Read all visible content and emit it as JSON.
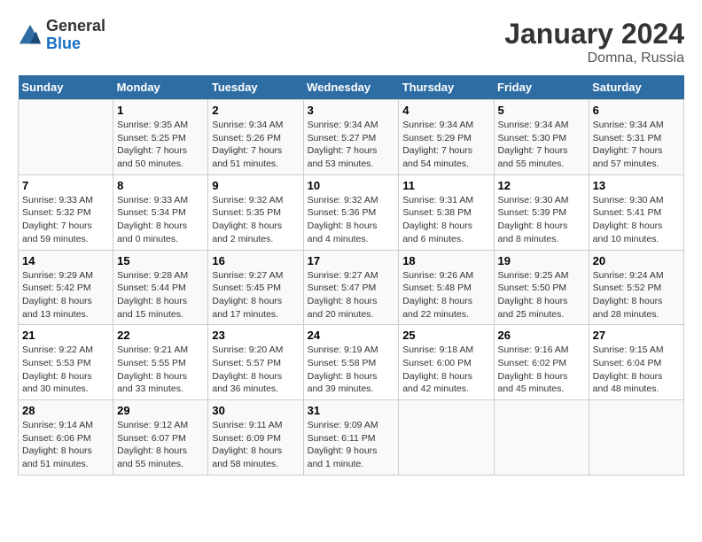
{
  "header": {
    "logo_general": "General",
    "logo_blue": "Blue",
    "title": "January 2024",
    "subtitle": "Domna, Russia"
  },
  "days_of_week": [
    "Sunday",
    "Monday",
    "Tuesday",
    "Wednesday",
    "Thursday",
    "Friday",
    "Saturday"
  ],
  "weeks": [
    [
      {
        "day": "",
        "info": ""
      },
      {
        "day": "1",
        "info": "Sunrise: 9:35 AM\nSunset: 5:25 PM\nDaylight: 7 hours\nand 50 minutes."
      },
      {
        "day": "2",
        "info": "Sunrise: 9:34 AM\nSunset: 5:26 PM\nDaylight: 7 hours\nand 51 minutes."
      },
      {
        "day": "3",
        "info": "Sunrise: 9:34 AM\nSunset: 5:27 PM\nDaylight: 7 hours\nand 53 minutes."
      },
      {
        "day": "4",
        "info": "Sunrise: 9:34 AM\nSunset: 5:29 PM\nDaylight: 7 hours\nand 54 minutes."
      },
      {
        "day": "5",
        "info": "Sunrise: 9:34 AM\nSunset: 5:30 PM\nDaylight: 7 hours\nand 55 minutes."
      },
      {
        "day": "6",
        "info": "Sunrise: 9:34 AM\nSunset: 5:31 PM\nDaylight: 7 hours\nand 57 minutes."
      }
    ],
    [
      {
        "day": "7",
        "info": "Sunrise: 9:33 AM\nSunset: 5:32 PM\nDaylight: 7 hours\nand 59 minutes."
      },
      {
        "day": "8",
        "info": "Sunrise: 9:33 AM\nSunset: 5:34 PM\nDaylight: 8 hours\nand 0 minutes."
      },
      {
        "day": "9",
        "info": "Sunrise: 9:32 AM\nSunset: 5:35 PM\nDaylight: 8 hours\nand 2 minutes."
      },
      {
        "day": "10",
        "info": "Sunrise: 9:32 AM\nSunset: 5:36 PM\nDaylight: 8 hours\nand 4 minutes."
      },
      {
        "day": "11",
        "info": "Sunrise: 9:31 AM\nSunset: 5:38 PM\nDaylight: 8 hours\nand 6 minutes."
      },
      {
        "day": "12",
        "info": "Sunrise: 9:30 AM\nSunset: 5:39 PM\nDaylight: 8 hours\nand 8 minutes."
      },
      {
        "day": "13",
        "info": "Sunrise: 9:30 AM\nSunset: 5:41 PM\nDaylight: 8 hours\nand 10 minutes."
      }
    ],
    [
      {
        "day": "14",
        "info": "Sunrise: 9:29 AM\nSunset: 5:42 PM\nDaylight: 8 hours\nand 13 minutes."
      },
      {
        "day": "15",
        "info": "Sunrise: 9:28 AM\nSunset: 5:44 PM\nDaylight: 8 hours\nand 15 minutes."
      },
      {
        "day": "16",
        "info": "Sunrise: 9:27 AM\nSunset: 5:45 PM\nDaylight: 8 hours\nand 17 minutes."
      },
      {
        "day": "17",
        "info": "Sunrise: 9:27 AM\nSunset: 5:47 PM\nDaylight: 8 hours\nand 20 minutes."
      },
      {
        "day": "18",
        "info": "Sunrise: 9:26 AM\nSunset: 5:48 PM\nDaylight: 8 hours\nand 22 minutes."
      },
      {
        "day": "19",
        "info": "Sunrise: 9:25 AM\nSunset: 5:50 PM\nDaylight: 8 hours\nand 25 minutes."
      },
      {
        "day": "20",
        "info": "Sunrise: 9:24 AM\nSunset: 5:52 PM\nDaylight: 8 hours\nand 28 minutes."
      }
    ],
    [
      {
        "day": "21",
        "info": "Sunrise: 9:22 AM\nSunset: 5:53 PM\nDaylight: 8 hours\nand 30 minutes."
      },
      {
        "day": "22",
        "info": "Sunrise: 9:21 AM\nSunset: 5:55 PM\nDaylight: 8 hours\nand 33 minutes."
      },
      {
        "day": "23",
        "info": "Sunrise: 9:20 AM\nSunset: 5:57 PM\nDaylight: 8 hours\nand 36 minutes."
      },
      {
        "day": "24",
        "info": "Sunrise: 9:19 AM\nSunset: 5:58 PM\nDaylight: 8 hours\nand 39 minutes."
      },
      {
        "day": "25",
        "info": "Sunrise: 9:18 AM\nSunset: 6:00 PM\nDaylight: 8 hours\nand 42 minutes."
      },
      {
        "day": "26",
        "info": "Sunrise: 9:16 AM\nSunset: 6:02 PM\nDaylight: 8 hours\nand 45 minutes."
      },
      {
        "day": "27",
        "info": "Sunrise: 9:15 AM\nSunset: 6:04 PM\nDaylight: 8 hours\nand 48 minutes."
      }
    ],
    [
      {
        "day": "28",
        "info": "Sunrise: 9:14 AM\nSunset: 6:06 PM\nDaylight: 8 hours\nand 51 minutes."
      },
      {
        "day": "29",
        "info": "Sunrise: 9:12 AM\nSunset: 6:07 PM\nDaylight: 8 hours\nand 55 minutes."
      },
      {
        "day": "30",
        "info": "Sunrise: 9:11 AM\nSunset: 6:09 PM\nDaylight: 8 hours\nand 58 minutes."
      },
      {
        "day": "31",
        "info": "Sunrise: 9:09 AM\nSunset: 6:11 PM\nDaylight: 9 hours\nand 1 minute."
      },
      {
        "day": "",
        "info": ""
      },
      {
        "day": "",
        "info": ""
      },
      {
        "day": "",
        "info": ""
      }
    ]
  ]
}
